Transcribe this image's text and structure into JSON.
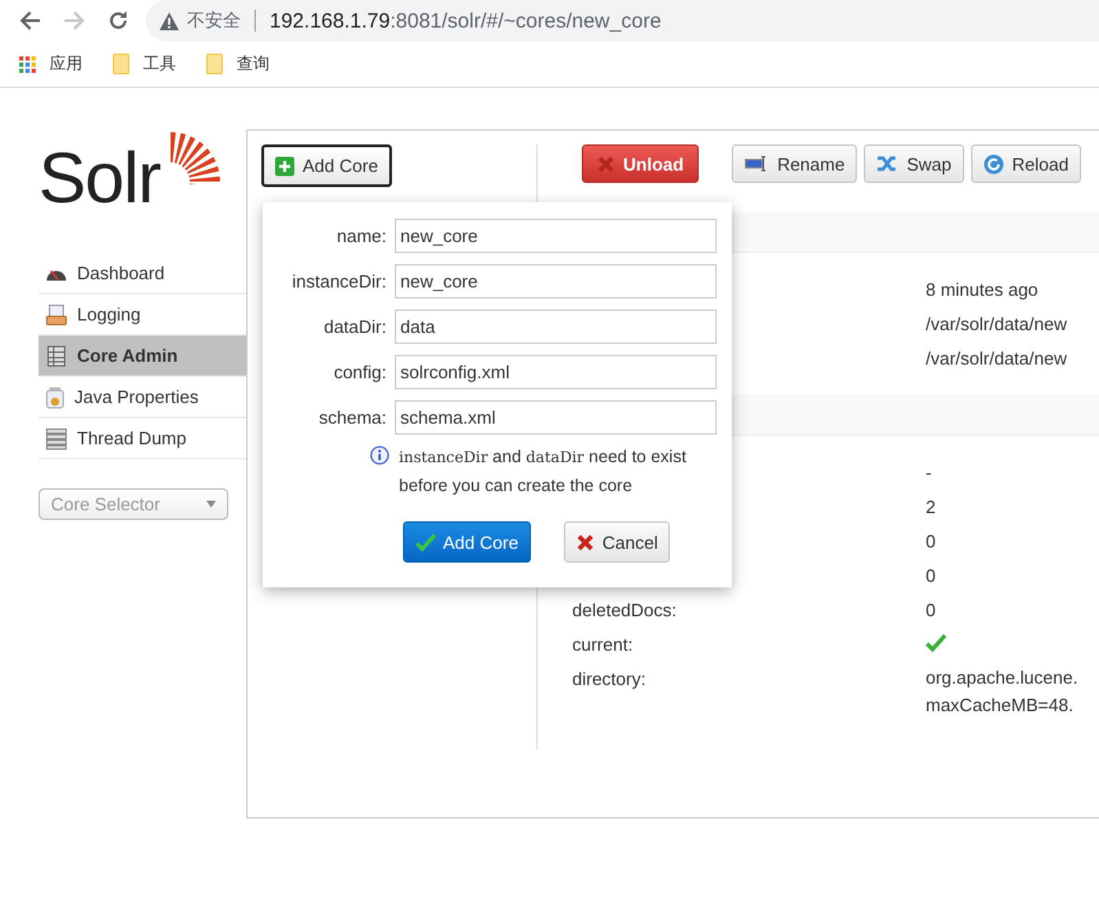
{
  "browser": {
    "security_label": "不安全",
    "url_host": "192.168.1.79",
    "url_path": ":8081/solr/#/~cores/new_core",
    "forward_disabled": true,
    "bookmarks": [
      {
        "kind": "apps",
        "label": "应用"
      },
      {
        "kind": "folder",
        "label": "工具"
      },
      {
        "kind": "folder",
        "label": "查询"
      }
    ]
  },
  "logo": {
    "text": "Solr"
  },
  "sidebar": {
    "items": [
      {
        "label": "Dashboard",
        "selected": false
      },
      {
        "label": "Logging",
        "selected": false
      },
      {
        "label": "Core Admin",
        "selected": true
      },
      {
        "label": "Java Properties",
        "selected": false
      },
      {
        "label": "Thread Dump",
        "selected": false
      }
    ],
    "core_selector": {
      "placeholder": "Core Selector"
    }
  },
  "toolbar": {
    "add_core": "Add Core",
    "actions": [
      {
        "kind": "unload",
        "label": "Unload"
      },
      {
        "kind": "rename",
        "label": "Rename"
      },
      {
        "kind": "swap",
        "label": "Swap"
      },
      {
        "kind": "reload",
        "label": "Reload"
      }
    ]
  },
  "sections": [
    {
      "rows": [
        {
          "kind": "text",
          "value": "8 minutes ago"
        },
        {
          "kind": "text",
          "value": "/var/solr/data/new"
        },
        {
          "kind": "text",
          "value": "/var/solr/data/new"
        }
      ]
    },
    {
      "rows": [
        {
          "kind": "text",
          "value": "-"
        },
        {
          "kind": "text",
          "value": "2"
        },
        {
          "kind": "text",
          "value": "0"
        },
        {
          "kind": "text",
          "value": "0"
        },
        {
          "kind": "text",
          "label": "deletedDocs:",
          "value": "0"
        },
        {
          "kind": "check",
          "label": "current:",
          "checked": true
        },
        {
          "kind": "lines",
          "label": "directory:",
          "lines": [
            "org.apache.lucene.",
            "maxCacheMB=48."
          ]
        }
      ]
    }
  ],
  "add_core_dialog": {
    "fields": [
      {
        "label": "name:",
        "value": "new_core"
      },
      {
        "label": "instanceDir:",
        "value": "new_core"
      },
      {
        "label": "dataDir:",
        "value": "data"
      },
      {
        "label": "config:",
        "value": "solrconfig.xml"
      },
      {
        "label": "schema:",
        "value": "schema.xml"
      }
    ],
    "hint": [
      {
        "text": "instanceDir",
        "code": true
      },
      {
        "text": " and ",
        "code": false
      },
      {
        "text": "dataDir",
        "code": true
      },
      {
        "text": " need to exist before you can create the core",
        "code": false
      }
    ],
    "submit": "Add Core",
    "cancel": "Cancel"
  }
}
